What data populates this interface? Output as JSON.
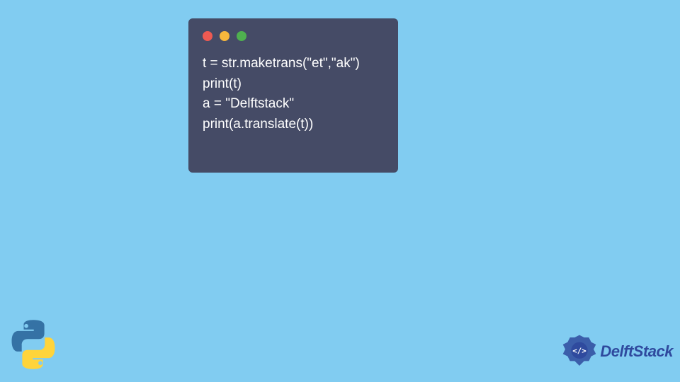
{
  "window": {
    "dots": {
      "red": "#ee5a52",
      "yellow": "#f6b73c",
      "green": "#4fb04f"
    },
    "bg": "#454b66"
  },
  "code": {
    "line1": "t = str.maketrans(\"et\",\"ak\")",
    "line2": "print(t)",
    "line3": "a = \"Delftstack\"",
    "line4": "print(a.translate(t))"
  },
  "logos": {
    "python": "python-logo",
    "delft_text": "DelftStack"
  },
  "colors": {
    "page_bg": "#81ccf1",
    "delft_blue": "#2f4a9e"
  }
}
